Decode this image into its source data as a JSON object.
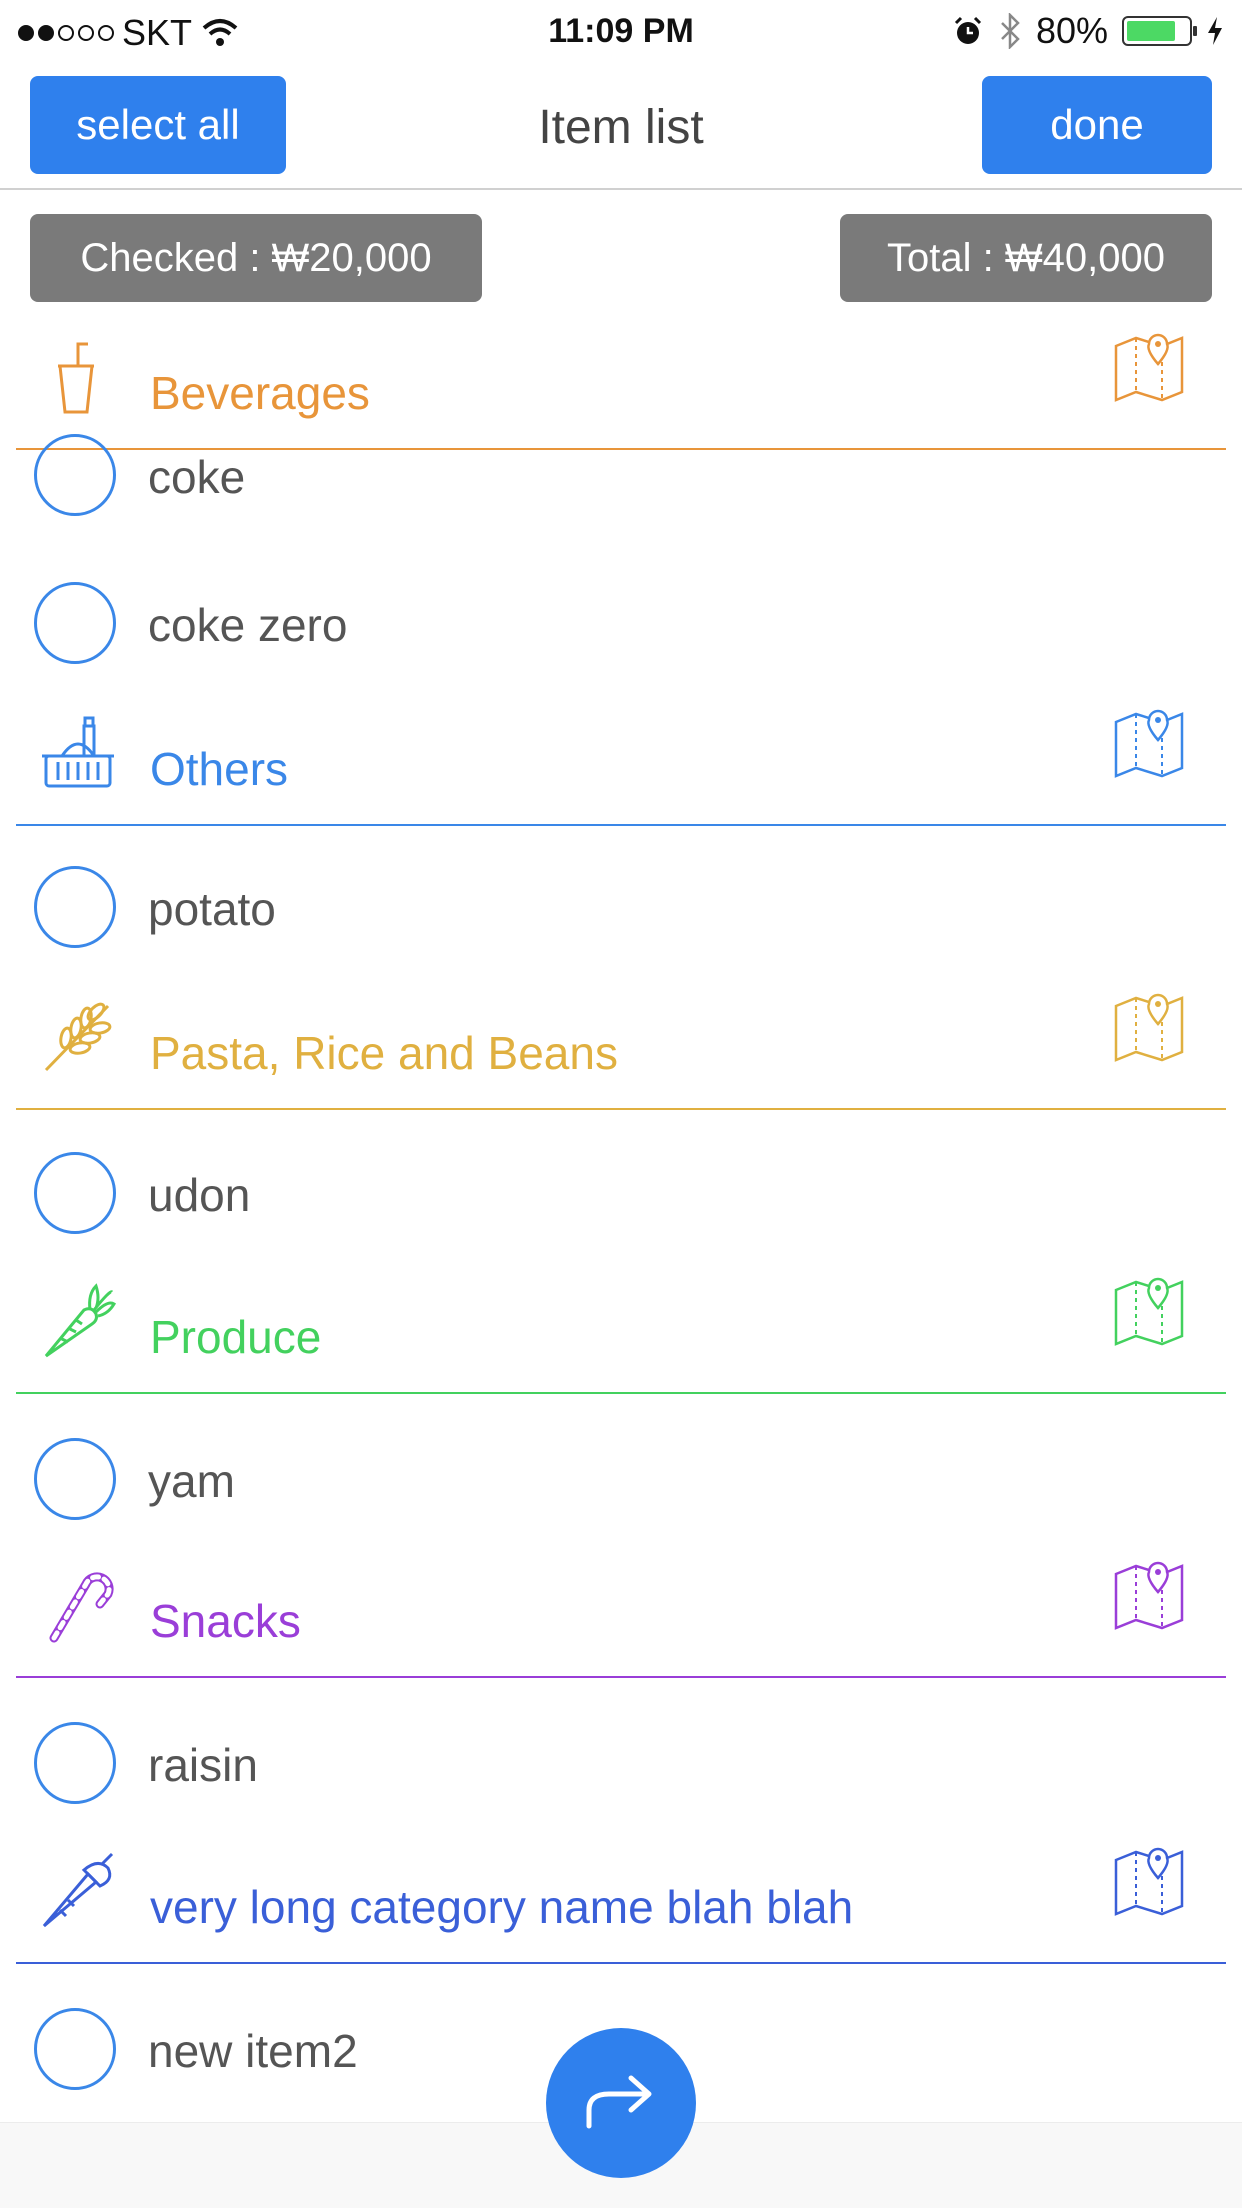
{
  "status_bar": {
    "carrier": "SKT",
    "time": "11:09 PM",
    "battery": "80%"
  },
  "nav": {
    "select_all_label": "select all",
    "title": "Item list",
    "done_label": "done"
  },
  "summary": {
    "checked": "Checked : ₩20,000",
    "total": "Total : ₩40,000"
  },
  "categories": [
    {
      "name": "Beverages",
      "color": "#e8953a",
      "icon": "cup-icon",
      "items": [
        "coke",
        "coke zero"
      ]
    },
    {
      "name": "Others",
      "color": "#3a87e8",
      "icon": "basket-icon",
      "items": [
        "potato"
      ]
    },
    {
      "name": "Pasta, Rice and Beans",
      "color": "#e0b040",
      "icon": "wheat-icon",
      "items": [
        "udon"
      ]
    },
    {
      "name": "Produce",
      "color": "#43d15e",
      "icon": "carrot-icon",
      "items": [
        "yam"
      ]
    },
    {
      "name": "Snacks",
      "color": "#9a3ed8",
      "icon": "candy-cane-icon",
      "items": [
        "raisin"
      ]
    },
    {
      "name": "very long category name blah blah",
      "color": "#3a5fd8",
      "icon": "piping-bag-icon",
      "items": [
        "new item2"
      ]
    }
  ],
  "fab": {
    "icon": "share-arrow-icon"
  }
}
